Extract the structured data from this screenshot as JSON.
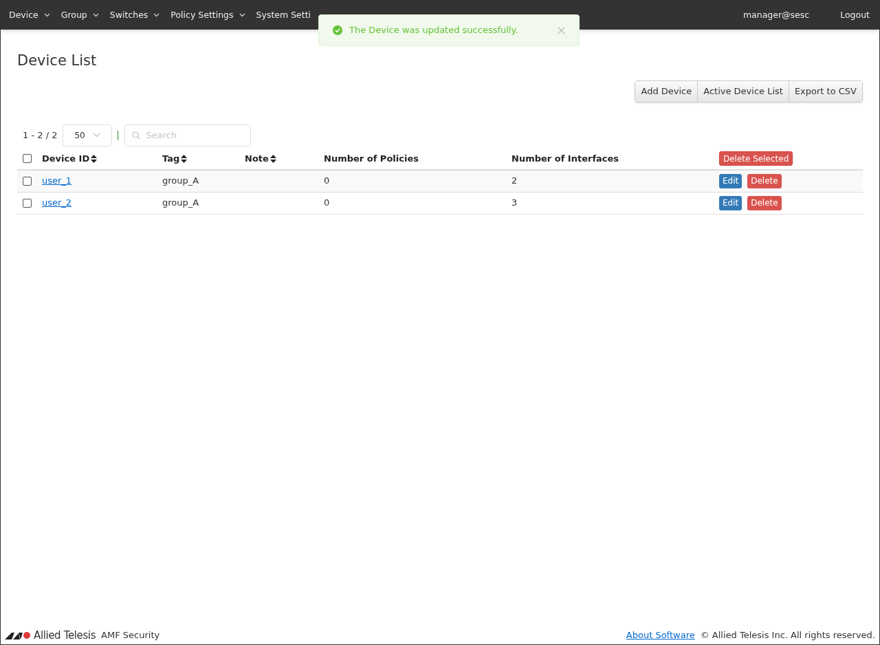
{
  "nav": {
    "items": [
      {
        "label": "Device",
        "dropdown": true
      },
      {
        "label": "Group",
        "dropdown": true
      },
      {
        "label": "Switches",
        "dropdown": true
      },
      {
        "label": "Policy Settings",
        "dropdown": true
      },
      {
        "label": "System Setti",
        "dropdown": false
      }
    ],
    "user": "manager@sesc",
    "logout": "Logout"
  },
  "toast": {
    "message": "The Device was updated successfully."
  },
  "page_title": "Device List",
  "actions": [
    "Add Device",
    "Active Device List",
    "Export to CSV"
  ],
  "pager": {
    "range": "1 - 2 / 2",
    "page_size": "50",
    "search_placeholder": "Search"
  },
  "table": {
    "columns": [
      {
        "label": "Device ID",
        "sortable": true
      },
      {
        "label": "Tag",
        "sortable": true
      },
      {
        "label": "Note",
        "sortable": true
      },
      {
        "label": "Number of Policies",
        "sortable": false
      },
      {
        "label": "Number of Interfaces",
        "sortable": false
      }
    ],
    "select_all_checked": false,
    "delete_selected": "Delete Selected",
    "rows": [
      {
        "id": "user_1",
        "tag": "group_A",
        "note": "",
        "policies": "0",
        "interfaces": "2",
        "checked": false,
        "edit": "Edit",
        "delete": "Delete"
      },
      {
        "id": "user_2",
        "tag": "group_A",
        "note": "",
        "policies": "0",
        "interfaces": "3",
        "checked": false,
        "edit": "Edit",
        "delete": "Delete"
      }
    ]
  },
  "footer": {
    "logo_text": "Allied Telesis",
    "product": "AMF Security",
    "about": "About Software",
    "copyright": "© Allied Telesis Inc. All rights reserved."
  }
}
